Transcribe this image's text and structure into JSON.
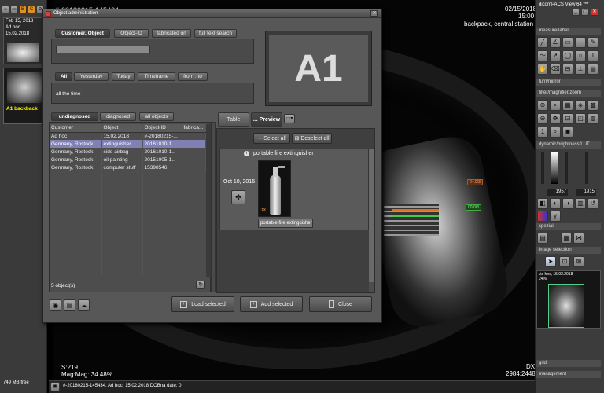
{
  "app": {
    "title": "dicomPACS View 64 ***",
    "icons": [
      "close-icon",
      "minimize-icon",
      "restore-icon"
    ]
  },
  "left": {
    "thumb1_date": "Feb 15, 2018",
    "thumb1_line2": "Ad hoc",
    "thumb1_line3": "15.02.2018",
    "thumb2_label": "A1 backback",
    "memory": "749 MB free"
  },
  "viewer": {
    "series_id": "#-20180215-145434",
    "date": "02/15/2018",
    "time": "15:00",
    "description": "backpack, central station",
    "tag_orange": "04.0/3",
    "tag_green": "00.0/3",
    "scale": "S:219",
    "mag": "Mag:Mag: 34.48%",
    "modality": "DX",
    "dims": "2984:2448",
    "status_bar": "#-20180215-145434, Ad hoc, 15.02.2018 DOBna date: 0"
  },
  "right": {
    "sections": [
      "measure/label",
      "turn/mirror",
      "filter/magnifier/zoom",
      "dynamic/brightness/LUT",
      "spezial",
      "image selection",
      "grid",
      "management"
    ],
    "window_level": "1957",
    "window_width": "1915",
    "preview_label": "Ad hoc, 15.02.2018",
    "preview_sub": "24%"
  },
  "dialog": {
    "title": "Object administration",
    "search_tabs": [
      "Customer, Object",
      "Object-ID",
      "fabricated on",
      "full text search"
    ],
    "search_value": "",
    "date_tabs": [
      "All",
      "Yesterday",
      "Today",
      "Timeframe",
      "from : to"
    ],
    "date_value": "all the time",
    "preview_label": "A1",
    "status_tabs": [
      "undiagnosed",
      "diagnosed",
      "all objects"
    ],
    "columns": [
      "Customer",
      "Object",
      "Object-ID",
      "fabrica..."
    ],
    "rows": [
      [
        "Ad hoc",
        "15.02.2018",
        "#-20180215-...",
        ""
      ],
      [
        "Germany, Rostock",
        "extinguisher",
        "20161010-1...",
        ""
      ],
      [
        "Germany, Rostock",
        "side airbag",
        "20161010-1...",
        ""
      ],
      [
        "Germany, Rostock",
        "oil painting",
        "20151005-1...",
        ""
      ],
      [
        "Germany, Rostock",
        "computer stuff",
        "15398546",
        ""
      ]
    ],
    "count": "5 object(s)",
    "view_tabs": [
      "Table",
      "... Preview"
    ],
    "select_all": "Select all",
    "deselect_all": "Deselect all",
    "preview_item_title": "portable fire extinguisher",
    "preview_item_date": "Oct 10, 2016",
    "preview_item_badge": "DX",
    "preview_item_caption": "portable fire extinguisher",
    "load_selected": "Load selected",
    "add_selected": "Add selected",
    "close": "Close"
  }
}
